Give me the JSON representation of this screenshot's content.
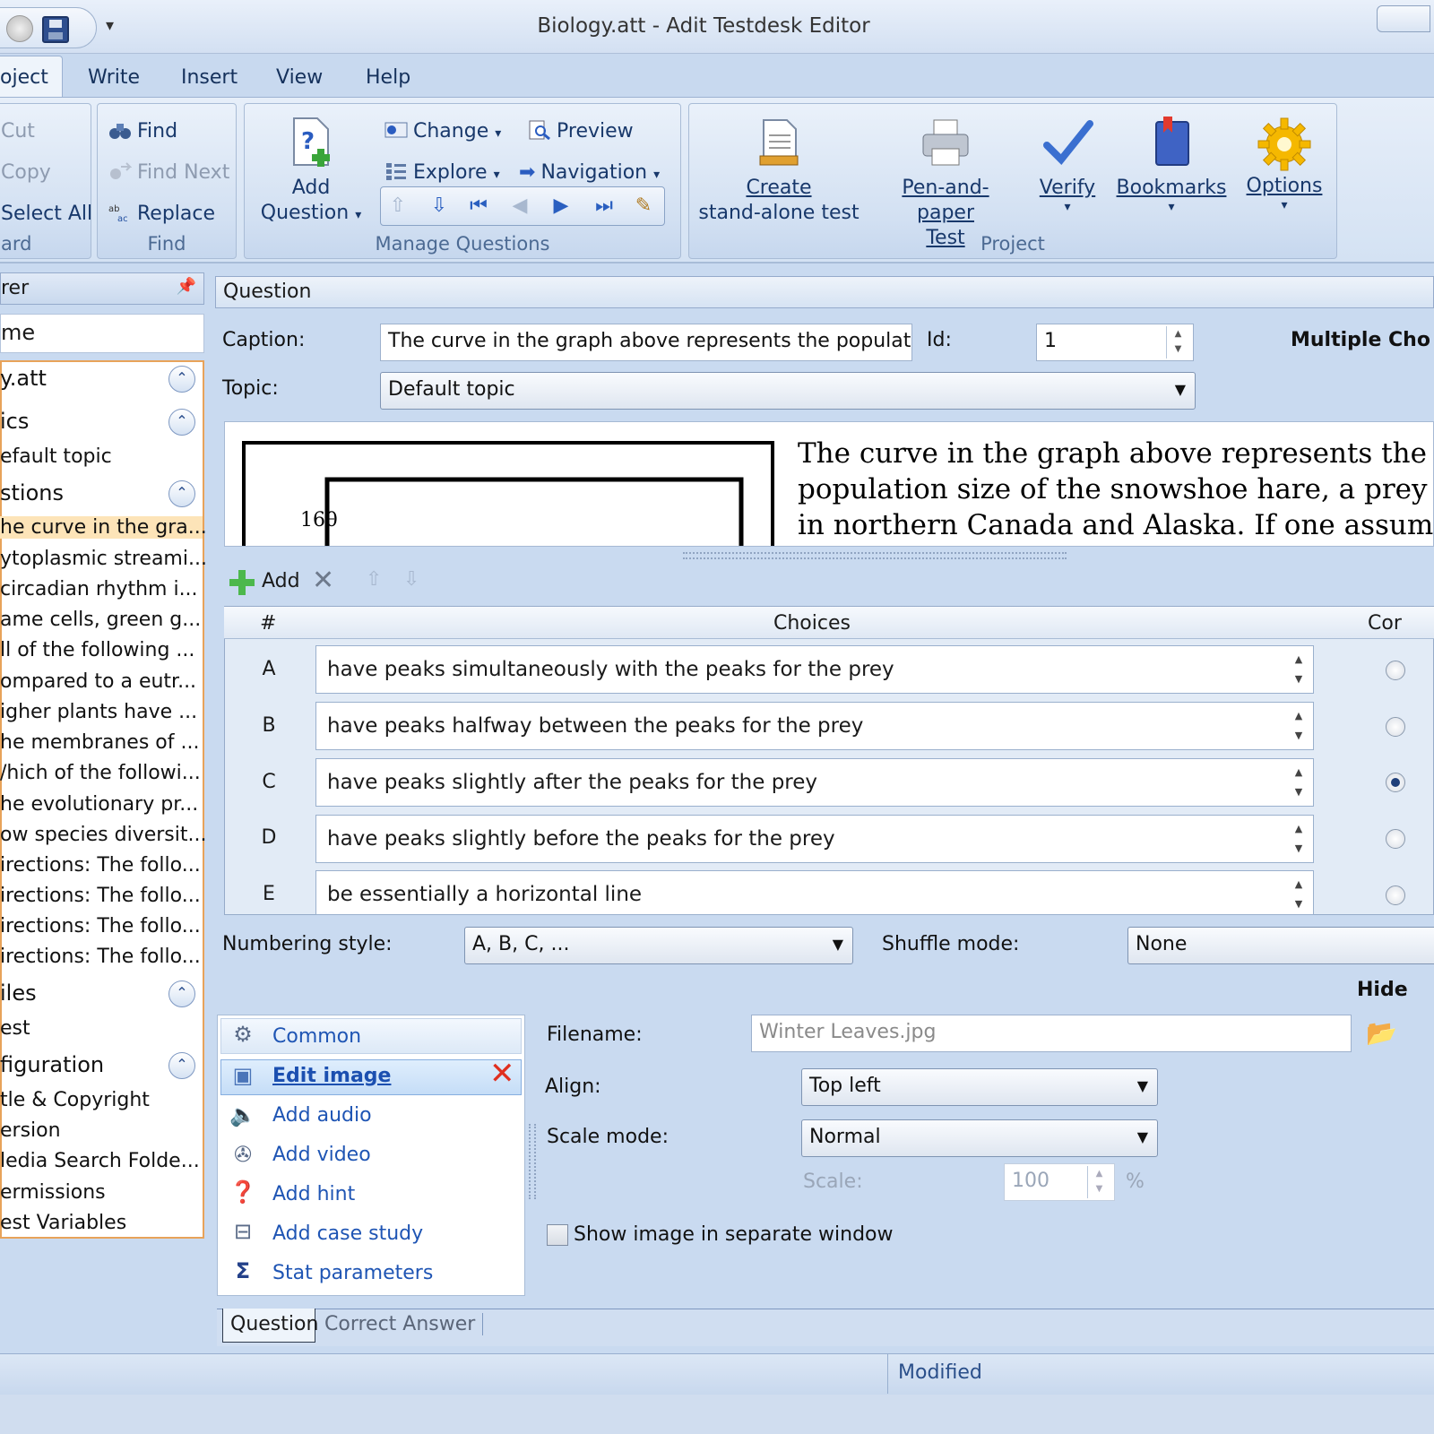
{
  "window": {
    "title": "Biology.att - Adit Testdesk Editor"
  },
  "menu": {
    "tabs": [
      "oject",
      "Write",
      "Insert",
      "View",
      "Help"
    ]
  },
  "ribbon": {
    "clipboard": {
      "cut": "Cut",
      "copy": "Copy",
      "select_all": "Select All",
      "group_label": "ard"
    },
    "find": {
      "find": "Find",
      "find_next": "Find Next",
      "replace": "Replace",
      "group_label": "Find"
    },
    "manage": {
      "add_question": "Add\nQuestion",
      "add_line1": "Add",
      "add_line2": "Question",
      "change": "Change",
      "explore": "Explore",
      "preview": "Preview",
      "navigation": "Navigation",
      "group_label": "Manage Questions"
    },
    "project": {
      "create_line1": "Create",
      "create_line2": "stand-alone test",
      "pen_line1": "Pen-and-paper",
      "pen_line2": "Test",
      "verify": "Verify",
      "bookmarks": "Bookmarks",
      "options": "Options",
      "group_label": "Project"
    }
  },
  "explorer": {
    "header": "rer",
    "search": "me",
    "tree": {
      "root": "y.att",
      "topics": "ics",
      "default_topic": "efault topic",
      "questions": "stions",
      "items": [
        "he curve in the gra...",
        "ytoplasmic streami...",
        " circadian rhythm i...",
        "ame cells, green g...",
        "ll of the following ...",
        "ompared to a eutr...",
        "igher plants have ...",
        "he membranes of ...",
        "/hich of the followi...",
        "he evolutionary pr...",
        "ow species diversit...",
        "irections: The follo...",
        "irections: The follo...",
        "irections: The follo...",
        "irections: The follo..."
      ],
      "files": "iles",
      "test": "est",
      "configuration": "figuration",
      "config_items": [
        "tle & Copyright",
        "ersion",
        "ledia Search Folde...",
        "ermissions",
        "est Variables"
      ]
    }
  },
  "question": {
    "header": "Question",
    "caption_label": "Caption:",
    "caption_value": "The curve in the graph above represents the population siz",
    "id_label": "Id:",
    "id_value": "1",
    "type_label": "Multiple Cho",
    "topic_label": "Topic:",
    "topic_value": "Default topic",
    "preview_lines": [
      "The curve in the graph above represents the",
      "population size of the snowshoe hare, a prey spe",
      "in northern Canada and Alaska. If one assumes t"
    ],
    "graph_tick": "160"
  },
  "choices": {
    "add_label": "Add",
    "col_num": "#",
    "col_choices": "Choices",
    "col_correct": "Cor",
    "rows": [
      {
        "letter": "A",
        "text": "have peaks simultaneously with the peaks for the prey"
      },
      {
        "letter": "B",
        "text": "have peaks halfway between the peaks for the prey"
      },
      {
        "letter": "C",
        "text": "have peaks slightly after the peaks for the prey"
      },
      {
        "letter": "D",
        "text": "have peaks slightly before the peaks for the prey"
      },
      {
        "letter": "E",
        "text": "be essentially a horizontal line"
      }
    ],
    "correct_index": 2,
    "numbering_label": "Numbering style:",
    "numbering_value": "A, B, C, ...",
    "shuffle_label": "Shuffle mode:",
    "shuffle_value": "None",
    "hide_label": "Hide"
  },
  "media": {
    "items": [
      "Common",
      "Edit image",
      "Add audio",
      "Add video",
      "Add hint",
      "Add case study",
      "Stat parameters"
    ],
    "filename_label": "Filename:",
    "filename_value": "Winter Leaves.jpg",
    "align_label": "Align:",
    "align_value": "Top left",
    "scale_mode_label": "Scale mode:",
    "scale_mode_value": "Normal",
    "scale_label": "Scale:",
    "scale_value": "100",
    "scale_unit": "%",
    "separate_window_label": "Show image in separate window"
  },
  "bottom_tabs": [
    "Question",
    "Correct Answer"
  ],
  "status": {
    "text": "Modified"
  }
}
